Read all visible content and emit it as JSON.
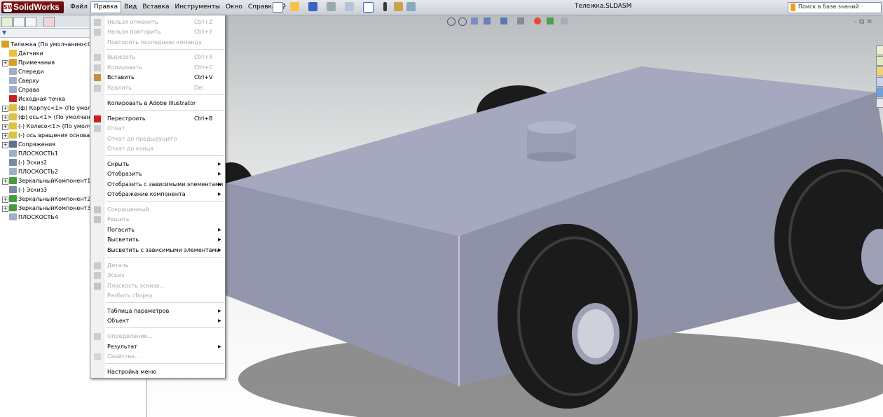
{
  "app": {
    "name": "SolidWorks",
    "logo_mark": "SW",
    "document_title": "Тележка.SLDASM"
  },
  "menubar": {
    "items": [
      "Файл",
      "Правка",
      "Вид",
      "Вставка",
      "Инструменты",
      "Окно",
      "Справка"
    ],
    "active": "Правка"
  },
  "search": {
    "placeholder": "Поиск в базе знаний"
  },
  "window_controls": "– ⧉ ✕",
  "feature_tree": {
    "root": "Тележка  (По умолчанию<Сос",
    "items": [
      {
        "label": "Датчики",
        "icon": "sensor-icon",
        "expander": ""
      },
      {
        "label": "Примечания",
        "icon": "annotation-icon",
        "expander": "+"
      },
      {
        "label": "Спереди",
        "icon": "plane-icon",
        "expander": ""
      },
      {
        "label": "Сверху",
        "icon": "plane-icon",
        "expander": ""
      },
      {
        "label": "Справа",
        "icon": "plane-icon",
        "expander": ""
      },
      {
        "label": "Исходная точка",
        "icon": "origin-icon",
        "expander": ""
      },
      {
        "label": "(ф) Корпус<1> (По умолча",
        "icon": "part-icon",
        "expander": "+"
      },
      {
        "label": "(ф) ось<1> (По умолчани",
        "icon": "part-icon",
        "expander": "+"
      },
      {
        "label": "(-) Колесо<1> (По умолчан",
        "icon": "part-icon",
        "expander": "+"
      },
      {
        "label": "(-) ось вращения основани",
        "icon": "part-icon",
        "expander": "+"
      },
      {
        "label": "Сопряжения",
        "icon": "mates-icon",
        "expander": "+"
      },
      {
        "label": "ПЛОСКОСТЬ1",
        "icon": "plane-icon",
        "expander": ""
      },
      {
        "label": "(-) Эскиз2",
        "icon": "sketch-icon",
        "expander": ""
      },
      {
        "label": "ПЛОСКОСТЬ2",
        "icon": "plane-icon",
        "expander": ""
      },
      {
        "label": "ЗеркальныйКомпонент1",
        "icon": "mirror-icon",
        "expander": "+"
      },
      {
        "label": "(-) Эскиз3",
        "icon": "sketch-icon",
        "expander": ""
      },
      {
        "label": "ЗеркальныйКомпонент2",
        "icon": "mirror-icon",
        "expander": "+"
      },
      {
        "label": "ЗеркальныйКомпонент3",
        "icon": "mirror-icon",
        "expander": "+"
      },
      {
        "label": "ПЛОСКОСТЬ4",
        "icon": "plane-icon",
        "expander": ""
      }
    ]
  },
  "edit_menu": {
    "items": [
      {
        "label": "Нельзя отменить",
        "shortcut": "Ctrl+Z",
        "disabled": true,
        "submenu": false,
        "icon": "undo-icon"
      },
      {
        "label": "Нельзя повторить",
        "shortcut": "Ctrl+Y",
        "disabled": true,
        "submenu": false,
        "icon": "redo-icon"
      },
      {
        "label": "Повторить последнюю команду",
        "shortcut": "",
        "disabled": true,
        "submenu": false,
        "icon": ""
      },
      {
        "label": "Вырезать",
        "shortcut": "Ctrl+X",
        "disabled": true,
        "submenu": false,
        "icon": "cut-icon"
      },
      {
        "label": "Копировать",
        "shortcut": "Ctrl+C",
        "disabled": true,
        "submenu": false,
        "icon": "copy-icon"
      },
      {
        "label": "Вставить",
        "shortcut": "Ctrl+V",
        "disabled": false,
        "submenu": false,
        "icon": "paste-icon"
      },
      {
        "label": "Удалить",
        "shortcut": "Del",
        "disabled": true,
        "submenu": false,
        "icon": "delete-icon"
      },
      {
        "label": "Копировать в Adobe Illustrator",
        "shortcut": "",
        "disabled": false,
        "submenu": false,
        "icon": ""
      },
      {
        "label": "Перестроить",
        "shortcut": "Ctrl+B",
        "disabled": false,
        "submenu": false,
        "icon": "rebuild-icon"
      },
      {
        "label": "Откат",
        "shortcut": "",
        "disabled": true,
        "submenu": false,
        "icon": "rollback-icon"
      },
      {
        "label": "Откат до предыдущего",
        "shortcut": "",
        "disabled": true,
        "submenu": false,
        "icon": ""
      },
      {
        "label": "Откат до конца",
        "shortcut": "",
        "disabled": true,
        "submenu": false,
        "icon": ""
      },
      {
        "label": "Скрыть",
        "shortcut": "",
        "disabled": false,
        "submenu": true,
        "icon": ""
      },
      {
        "label": "Отобразить",
        "shortcut": "",
        "disabled": false,
        "submenu": true,
        "icon": ""
      },
      {
        "label": "Отобразить с зависимыми элементами",
        "shortcut": "",
        "disabled": false,
        "submenu": true,
        "icon": ""
      },
      {
        "label": "Отображение компонента",
        "shortcut": "",
        "disabled": false,
        "submenu": true,
        "icon": ""
      },
      {
        "label": "Сокращенный",
        "shortcut": "",
        "disabled": true,
        "submenu": false,
        "icon": "suppress-icon"
      },
      {
        "label": "Решить",
        "shortcut": "",
        "disabled": true,
        "submenu": false,
        "icon": "resolve-icon"
      },
      {
        "label": "Погасить",
        "shortcut": "",
        "disabled": false,
        "submenu": true,
        "icon": ""
      },
      {
        "label": "Высветить",
        "shortcut": "",
        "disabled": false,
        "submenu": true,
        "icon": ""
      },
      {
        "label": "Высветить с зависимыми элементами",
        "shortcut": "",
        "disabled": false,
        "submenu": true,
        "icon": ""
      },
      {
        "label": "Деталь",
        "shortcut": "",
        "disabled": true,
        "submenu": false,
        "icon": "edit-part-icon"
      },
      {
        "label": "Эскиз",
        "shortcut": "",
        "disabled": true,
        "submenu": false,
        "icon": "edit-sketch-icon"
      },
      {
        "label": "Плоскость эскиза...",
        "shortcut": "",
        "disabled": true,
        "submenu": false,
        "icon": "sketch-plane-icon"
      },
      {
        "label": "Разбить сборку",
        "shortcut": "",
        "disabled": true,
        "submenu": false,
        "icon": ""
      },
      {
        "label": "Таблица параметров",
        "shortcut": "",
        "disabled": false,
        "submenu": true,
        "icon": ""
      },
      {
        "label": "Объект",
        "shortcut": "",
        "disabled": false,
        "submenu": true,
        "icon": ""
      },
      {
        "label": "Определение...",
        "shortcut": "",
        "disabled": true,
        "submenu": false,
        "icon": "definition-icon"
      },
      {
        "label": "Результат",
        "shortcut": "",
        "disabled": false,
        "submenu": true,
        "icon": ""
      },
      {
        "label": "Свойства...",
        "shortcut": "",
        "disabled": true,
        "submenu": false,
        "icon": "properties-icon"
      },
      {
        "label": "Настройка меню",
        "shortcut": "",
        "disabled": false,
        "submenu": false,
        "icon": ""
      }
    ]
  },
  "colors": {
    "accent": "#316ac5",
    "body_gray": "#9ea3b8",
    "tire": "#1b1b1b",
    "menu_disabled": "#a8a8a8"
  }
}
